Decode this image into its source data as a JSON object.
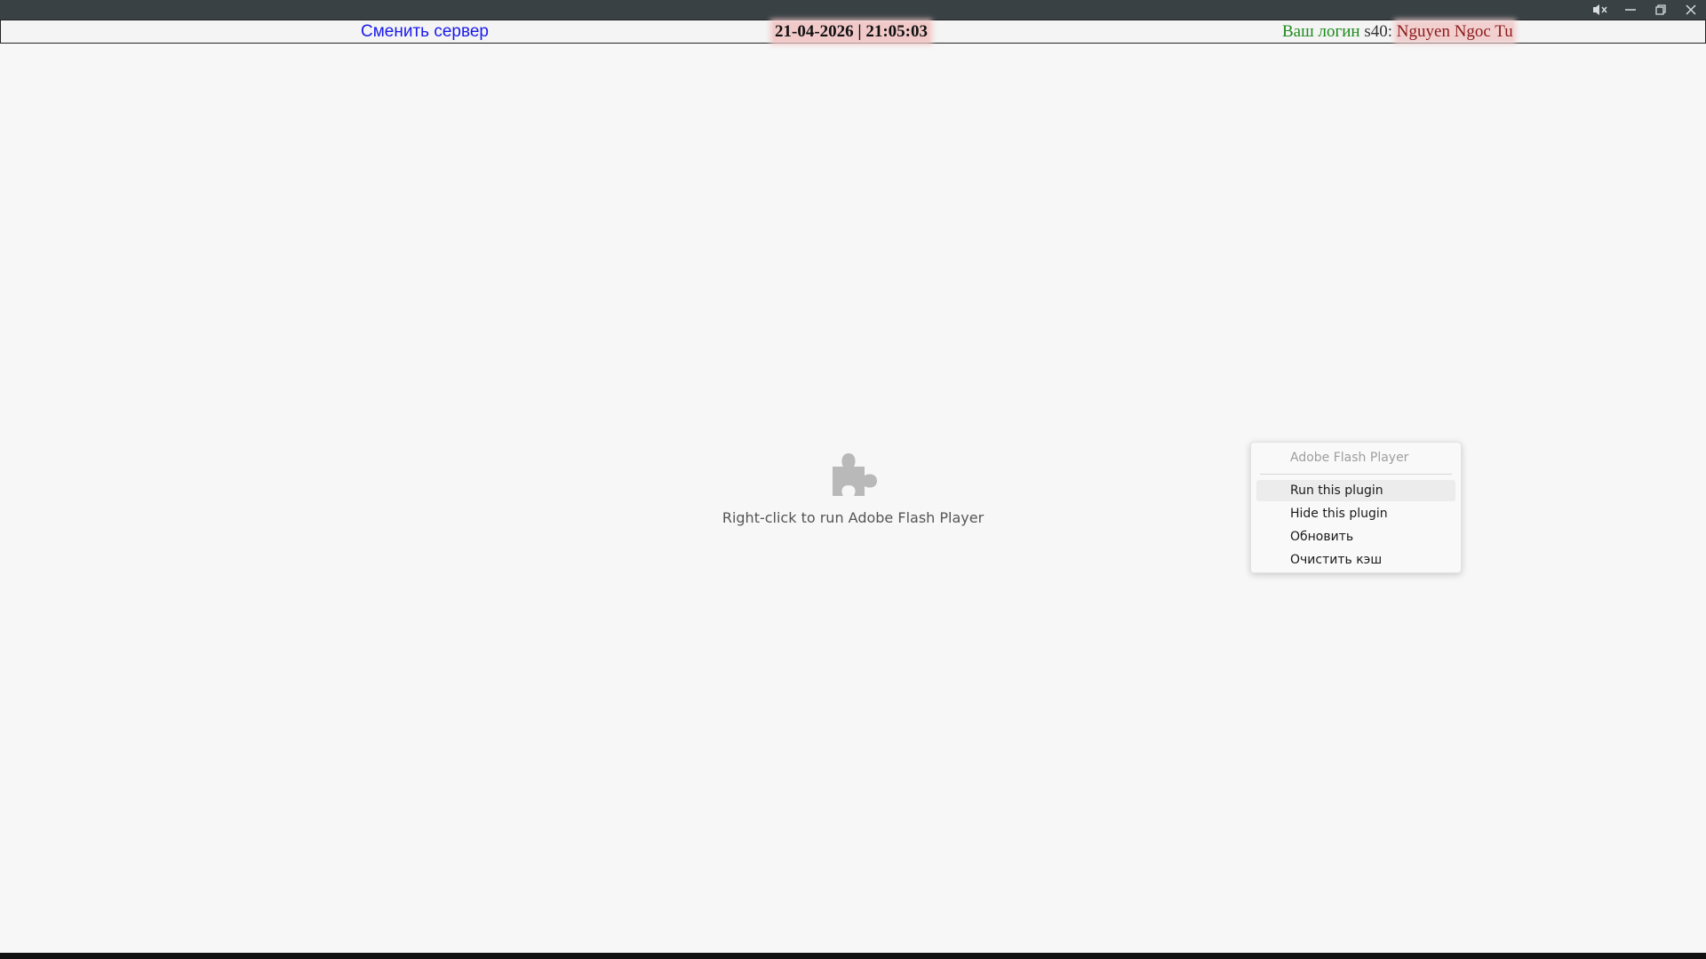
{
  "window": {
    "controls": {
      "mute_icon": "mute-icon",
      "minimize_icon": "minimize-icon",
      "restore_icon": "restore-icon",
      "close_icon": "close-icon"
    },
    "titlebar_color": "#394145"
  },
  "infobar": {
    "change_server": "Сменить сервер",
    "datetime": "21-04-2026 | 21:05:03",
    "login_label": "Ваш логин",
    "server": "s40:",
    "username": "Nguyen Ngoc Tu"
  },
  "plugin": {
    "icon": "puzzle-piece-icon",
    "message": "Right-click to run Adobe Flash Player"
  },
  "context_menu": {
    "header": "Adobe Flash Player",
    "items": [
      {
        "label": "Run this plugin",
        "highlighted": true
      },
      {
        "label": "Hide this plugin",
        "highlighted": false
      },
      {
        "label": "Обновить",
        "highlighted": false
      },
      {
        "label": "Очистить кэш",
        "highlighted": false
      }
    ]
  },
  "colors": {
    "link": "#1a1aeb",
    "login_label": "#1e8a1e",
    "username": "#8b1a1a",
    "highlight_bg": "#f2c9c9"
  }
}
